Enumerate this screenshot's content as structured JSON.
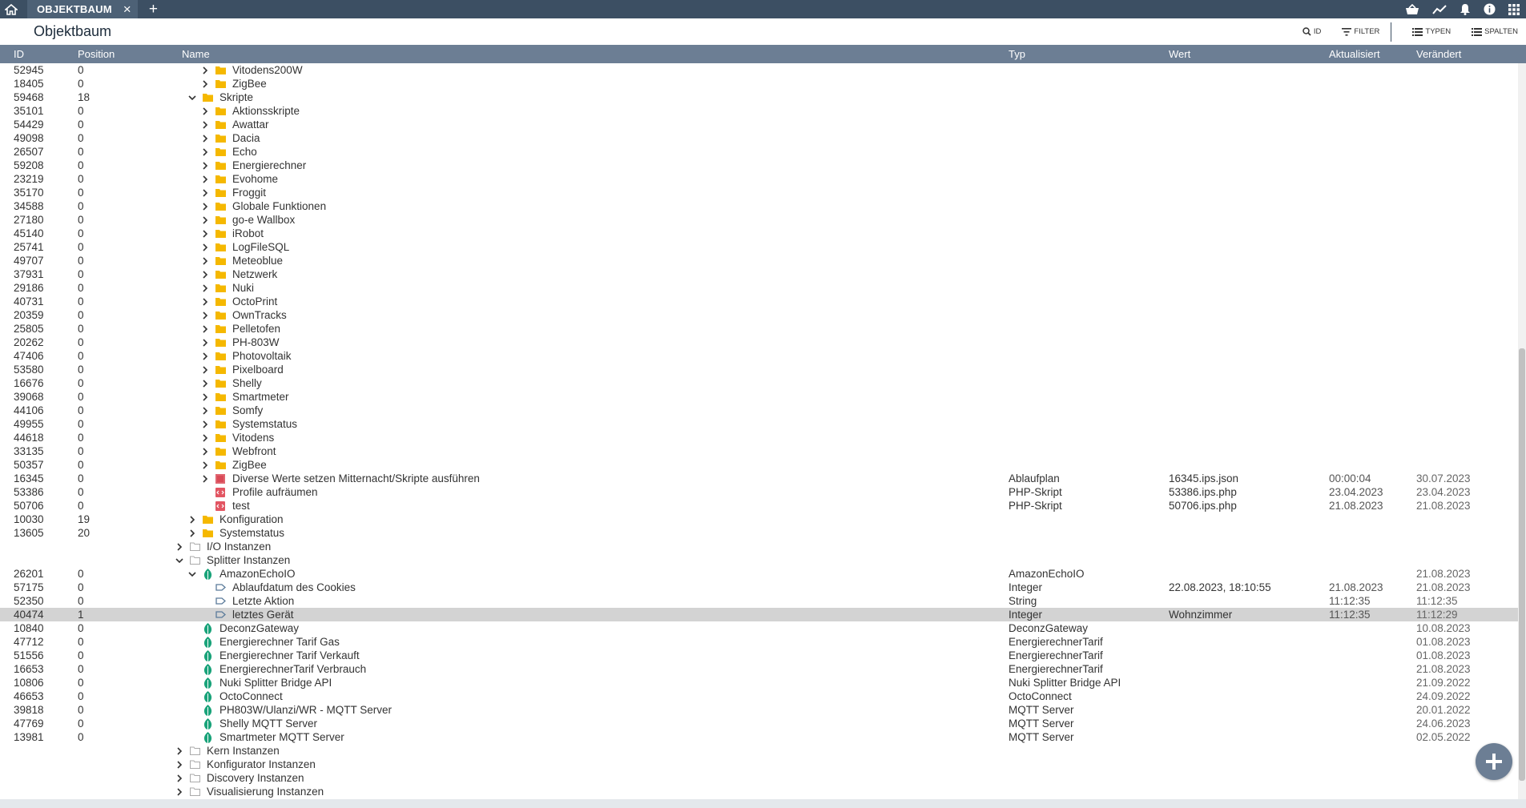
{
  "topbar": {
    "tab_label": "OBJEKTBAUM"
  },
  "toolbar": {
    "title": "Objektbaum",
    "id_label": "ID",
    "filter_label": "FILTER",
    "types_label": "TYPEN",
    "columns_label": "SPALTEN"
  },
  "columns": {
    "id": "ID",
    "position": "Position",
    "name": "Name",
    "typ": "Typ",
    "wert": "Wert",
    "aktualisiert": "Aktualisiert",
    "veraendert": "Verändert"
  },
  "colors": {
    "topbar": "#3c4f63",
    "header": "#6c7e94",
    "folder": "#f5b800",
    "instance": "#1aa37a",
    "selected_row": "#d3d3d3"
  },
  "rows": [
    {
      "id": "52945",
      "pos": "0",
      "name": "Vitodens200W",
      "level": 2,
      "chev": "right",
      "icon": "folder",
      "typ": "",
      "wert": "",
      "akt": "",
      "ver": ""
    },
    {
      "id": "18405",
      "pos": "0",
      "name": "ZigBee",
      "level": 2,
      "chev": "right",
      "icon": "folder",
      "typ": "",
      "wert": "",
      "akt": "",
      "ver": ""
    },
    {
      "id": "59468",
      "pos": "18",
      "name": "Skripte",
      "level": 1,
      "chev": "down",
      "icon": "folder",
      "typ": "",
      "wert": "",
      "akt": "",
      "ver": ""
    },
    {
      "id": "35101",
      "pos": "0",
      "name": "Aktionsskripte",
      "level": 2,
      "chev": "right",
      "icon": "folder",
      "typ": "",
      "wert": "",
      "akt": "",
      "ver": ""
    },
    {
      "id": "54429",
      "pos": "0",
      "name": "Awattar",
      "level": 2,
      "chev": "right",
      "icon": "folder",
      "typ": "",
      "wert": "",
      "akt": "",
      "ver": ""
    },
    {
      "id": "49098",
      "pos": "0",
      "name": "Dacia",
      "level": 2,
      "chev": "right",
      "icon": "folder",
      "typ": "",
      "wert": "",
      "akt": "",
      "ver": ""
    },
    {
      "id": "26507",
      "pos": "0",
      "name": "Echo",
      "level": 2,
      "chev": "right",
      "icon": "folder",
      "typ": "",
      "wert": "",
      "akt": "",
      "ver": ""
    },
    {
      "id": "59208",
      "pos": "0",
      "name": "Energierechner",
      "level": 2,
      "chev": "right",
      "icon": "folder",
      "typ": "",
      "wert": "",
      "akt": "",
      "ver": ""
    },
    {
      "id": "23219",
      "pos": "0",
      "name": "Evohome",
      "level": 2,
      "chev": "right",
      "icon": "folder",
      "typ": "",
      "wert": "",
      "akt": "",
      "ver": ""
    },
    {
      "id": "35170",
      "pos": "0",
      "name": "Froggit",
      "level": 2,
      "chev": "right",
      "icon": "folder",
      "typ": "",
      "wert": "",
      "akt": "",
      "ver": ""
    },
    {
      "id": "34588",
      "pos": "0",
      "name": "Globale Funktionen",
      "level": 2,
      "chev": "right",
      "icon": "folder",
      "typ": "",
      "wert": "",
      "akt": "",
      "ver": ""
    },
    {
      "id": "27180",
      "pos": "0",
      "name": "go-e Wallbox",
      "level": 2,
      "chev": "right",
      "icon": "folder",
      "typ": "",
      "wert": "",
      "akt": "",
      "ver": ""
    },
    {
      "id": "45140",
      "pos": "0",
      "name": "iRobot",
      "level": 2,
      "chev": "right",
      "icon": "folder",
      "typ": "",
      "wert": "",
      "akt": "",
      "ver": ""
    },
    {
      "id": "25741",
      "pos": "0",
      "name": "LogFileSQL",
      "level": 2,
      "chev": "right",
      "icon": "folder",
      "typ": "",
      "wert": "",
      "akt": "",
      "ver": ""
    },
    {
      "id": "49707",
      "pos": "0",
      "name": "Meteoblue",
      "level": 2,
      "chev": "right",
      "icon": "folder",
      "typ": "",
      "wert": "",
      "akt": "",
      "ver": ""
    },
    {
      "id": "37931",
      "pos": "0",
      "name": "Netzwerk",
      "level": 2,
      "chev": "right",
      "icon": "folder",
      "typ": "",
      "wert": "",
      "akt": "",
      "ver": ""
    },
    {
      "id": "29186",
      "pos": "0",
      "name": "Nuki",
      "level": 2,
      "chev": "right",
      "icon": "folder",
      "typ": "",
      "wert": "",
      "akt": "",
      "ver": ""
    },
    {
      "id": "40731",
      "pos": "0",
      "name": "OctoPrint",
      "level": 2,
      "chev": "right",
      "icon": "folder",
      "typ": "",
      "wert": "",
      "akt": "",
      "ver": ""
    },
    {
      "id": "20359",
      "pos": "0",
      "name": "OwnTracks",
      "level": 2,
      "chev": "right",
      "icon": "folder",
      "typ": "",
      "wert": "",
      "akt": "",
      "ver": ""
    },
    {
      "id": "25805",
      "pos": "0",
      "name": "Pelletofen",
      "level": 2,
      "chev": "right",
      "icon": "folder",
      "typ": "",
      "wert": "",
      "akt": "",
      "ver": ""
    },
    {
      "id": "20262",
      "pos": "0",
      "name": "PH-803W",
      "level": 2,
      "chev": "right",
      "icon": "folder",
      "typ": "",
      "wert": "",
      "akt": "",
      "ver": ""
    },
    {
      "id": "47406",
      "pos": "0",
      "name": "Photovoltaik",
      "level": 2,
      "chev": "right",
      "icon": "folder",
      "typ": "",
      "wert": "",
      "akt": "",
      "ver": ""
    },
    {
      "id": "53580",
      "pos": "0",
      "name": "Pixelboard",
      "level": 2,
      "chev": "right",
      "icon": "folder",
      "typ": "",
      "wert": "",
      "akt": "",
      "ver": ""
    },
    {
      "id": "16676",
      "pos": "0",
      "name": "Shelly",
      "level": 2,
      "chev": "right",
      "icon": "folder",
      "typ": "",
      "wert": "",
      "akt": "",
      "ver": ""
    },
    {
      "id": "39068",
      "pos": "0",
      "name": "Smartmeter",
      "level": 2,
      "chev": "right",
      "icon": "folder",
      "typ": "",
      "wert": "",
      "akt": "",
      "ver": ""
    },
    {
      "id": "44106",
      "pos": "0",
      "name": "Somfy",
      "level": 2,
      "chev": "right",
      "icon": "folder",
      "typ": "",
      "wert": "",
      "akt": "",
      "ver": ""
    },
    {
      "id": "49955",
      "pos": "0",
      "name": "Systemstatus",
      "level": 2,
      "chev": "right",
      "icon": "folder",
      "typ": "",
      "wert": "",
      "akt": "",
      "ver": ""
    },
    {
      "id": "44618",
      "pos": "0",
      "name": "Vitodens",
      "level": 2,
      "chev": "right",
      "icon": "folder",
      "typ": "",
      "wert": "",
      "akt": "",
      "ver": ""
    },
    {
      "id": "33135",
      "pos": "0",
      "name": "Webfront",
      "level": 2,
      "chev": "right",
      "icon": "folder",
      "typ": "",
      "wert": "",
      "akt": "",
      "ver": ""
    },
    {
      "id": "50357",
      "pos": "0",
      "name": "ZigBee",
      "level": 2,
      "chev": "right",
      "icon": "folder",
      "typ": "",
      "wert": "",
      "akt": "",
      "ver": ""
    },
    {
      "id": "16345",
      "pos": "0",
      "name": "Diverse Werte setzen Mitternacht/Skripte ausführen",
      "level": 2,
      "chev": "right",
      "icon": "flow",
      "typ": "Ablaufplan",
      "wert": "16345.ips.json",
      "akt": "00:00:04",
      "ver": "30.07.2023"
    },
    {
      "id": "53386",
      "pos": "0",
      "name": "Profile aufräumen",
      "level": 2,
      "chev": "none",
      "icon": "script",
      "typ": "PHP-Skript",
      "wert": "53386.ips.php",
      "akt": "23.04.2023",
      "ver": "23.04.2023"
    },
    {
      "id": "50706",
      "pos": "0",
      "name": "test",
      "level": 2,
      "chev": "none",
      "icon": "script",
      "typ": "PHP-Skript",
      "wert": "50706.ips.php",
      "akt": "21.08.2023",
      "ver": "21.08.2023"
    },
    {
      "id": "10030",
      "pos": "19",
      "name": "Konfiguration",
      "level": 1,
      "chev": "right",
      "icon": "folder",
      "typ": "",
      "wert": "",
      "akt": "",
      "ver": ""
    },
    {
      "id": "13605",
      "pos": "20",
      "name": "Systemstatus",
      "level": 1,
      "chev": "right",
      "icon": "folder",
      "typ": "",
      "wert": "",
      "akt": "",
      "ver": ""
    },
    {
      "id": "",
      "pos": "",
      "name": "I/O Instanzen",
      "level": 0,
      "chev": "right",
      "icon": "grayfolder",
      "typ": "",
      "wert": "",
      "akt": "",
      "ver": ""
    },
    {
      "id": "",
      "pos": "",
      "name": "Splitter Instanzen",
      "level": 0,
      "chev": "down",
      "icon": "grayfolder",
      "typ": "",
      "wert": "",
      "akt": "",
      "ver": ""
    },
    {
      "id": "26201",
      "pos": "0",
      "name": "AmazonEchoIO",
      "level": 1,
      "chev": "down",
      "icon": "instance",
      "typ": "AmazonEchoIO",
      "wert": "",
      "akt": "",
      "ver": "21.08.2023"
    },
    {
      "id": "57175",
      "pos": "0",
      "name": "Ablaufdatum des Cookies",
      "level": 2,
      "chev": "none",
      "icon": "variable",
      "typ": "Integer",
      "wert": "22.08.2023, 18:10:55",
      "akt": "21.08.2023",
      "ver": "21.08.2023"
    },
    {
      "id": "52350",
      "pos": "0",
      "name": "Letzte Aktion",
      "level": 2,
      "chev": "none",
      "icon": "variable",
      "typ": "String",
      "wert": "",
      "akt": "11:12:35",
      "ver": "11:12:35"
    },
    {
      "id": "40474",
      "pos": "1",
      "name": "letztes Gerät",
      "level": 2,
      "chev": "none",
      "icon": "variable",
      "typ": "Integer",
      "wert": "Wohnzimmer",
      "akt": "11:12:35",
      "ver": "11:12:29",
      "selected": true
    },
    {
      "id": "10840",
      "pos": "0",
      "name": "DeconzGateway",
      "level": 1,
      "chev": "none",
      "icon": "instance",
      "typ": "DeconzGateway",
      "wert": "",
      "akt": "",
      "ver": "10.08.2023"
    },
    {
      "id": "47712",
      "pos": "0",
      "name": "Energierechner Tarif Gas",
      "level": 1,
      "chev": "none",
      "icon": "instance",
      "typ": "EnergierechnerTarif",
      "wert": "",
      "akt": "",
      "ver": "01.08.2023"
    },
    {
      "id": "51556",
      "pos": "0",
      "name": "Energierechner Tarif Verkauft",
      "level": 1,
      "chev": "none",
      "icon": "instance",
      "typ": "EnergierechnerTarif",
      "wert": "",
      "akt": "",
      "ver": "01.08.2023"
    },
    {
      "id": "16653",
      "pos": "0",
      "name": "EnergierechnerTarif Verbrauch",
      "level": 1,
      "chev": "none",
      "icon": "instance",
      "typ": "EnergierechnerTarif",
      "wert": "",
      "akt": "",
      "ver": "21.08.2023"
    },
    {
      "id": "10806",
      "pos": "0",
      "name": "Nuki Splitter Bridge API",
      "level": 1,
      "chev": "none",
      "icon": "instance",
      "typ": "Nuki Splitter Bridge API",
      "wert": "",
      "akt": "",
      "ver": "21.09.2022"
    },
    {
      "id": "46653",
      "pos": "0",
      "name": "OctoConnect",
      "level": 1,
      "chev": "none",
      "icon": "instance",
      "typ": "OctoConnect",
      "wert": "",
      "akt": "",
      "ver": "24.09.2022"
    },
    {
      "id": "39818",
      "pos": "0",
      "name": "PH803W/Ulanzi/WR - MQTT Server",
      "level": 1,
      "chev": "none",
      "icon": "instance",
      "typ": "MQTT Server",
      "wert": "",
      "akt": "",
      "ver": "20.01.2022"
    },
    {
      "id": "47769",
      "pos": "0",
      "name": "Shelly MQTT Server",
      "level": 1,
      "chev": "none",
      "icon": "instance",
      "typ": "MQTT Server",
      "wert": "",
      "akt": "",
      "ver": "24.06.2023"
    },
    {
      "id": "13981",
      "pos": "0",
      "name": "Smartmeter MQTT Server",
      "level": 1,
      "chev": "none",
      "icon": "instance",
      "typ": "MQTT Server",
      "wert": "",
      "akt": "",
      "ver": "02.05.2022"
    },
    {
      "id": "",
      "pos": "",
      "name": "Kern Instanzen",
      "level": 0,
      "chev": "right",
      "icon": "grayfolder",
      "typ": "",
      "wert": "",
      "akt": "",
      "ver": ""
    },
    {
      "id": "",
      "pos": "",
      "name": "Konfigurator Instanzen",
      "level": 0,
      "chev": "right",
      "icon": "grayfolder",
      "typ": "",
      "wert": "",
      "akt": "",
      "ver": ""
    },
    {
      "id": "",
      "pos": "",
      "name": "Discovery Instanzen",
      "level": 0,
      "chev": "right",
      "icon": "grayfolder",
      "typ": "",
      "wert": "",
      "akt": "",
      "ver": ""
    },
    {
      "id": "",
      "pos": "",
      "name": "Visualisierung Instanzen",
      "level": 0,
      "chev": "right",
      "icon": "grayfolder",
      "typ": "",
      "wert": "",
      "akt": "",
      "ver": ""
    }
  ]
}
